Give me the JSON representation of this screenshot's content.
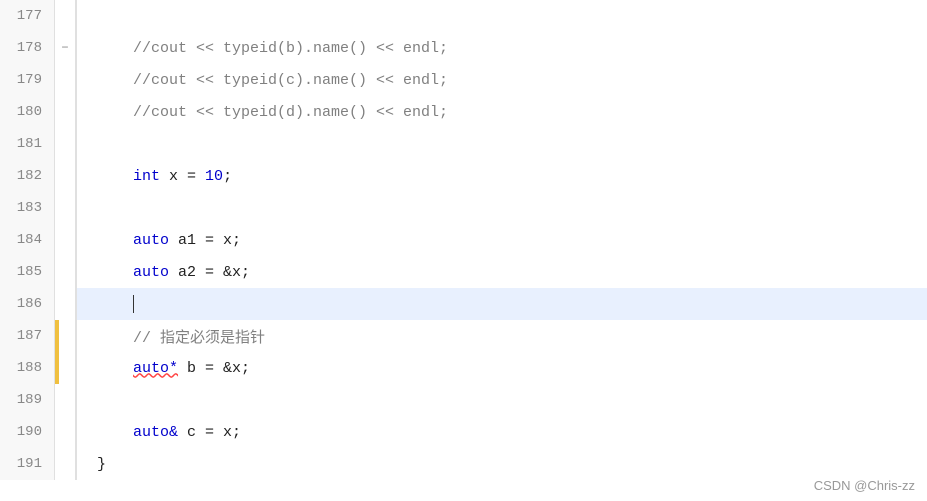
{
  "editor": {
    "lines": [
      {
        "number": "177",
        "gutter": "",
        "gutterStyle": "",
        "content": "",
        "tokens": []
      },
      {
        "number": "178",
        "gutter": "collapse",
        "gutterStyle": "",
        "content": "    //cout << typeid(b).name() << endl;",
        "tokens": [
          {
            "type": "cm",
            "text": "    //cout << typeid(b).name() << endl;"
          }
        ]
      },
      {
        "number": "179",
        "gutter": "",
        "gutterStyle": "",
        "content": "    //cout << typeid(c).name() << endl;",
        "tokens": [
          {
            "type": "cm",
            "text": "    //cout << typeid(c).name() << endl;"
          }
        ]
      },
      {
        "number": "180",
        "gutter": "",
        "gutterStyle": "",
        "content": "    //cout << typeid(d).name() << endl;",
        "tokens": [
          {
            "type": "cm",
            "text": "    //cout << typeid(d).name() << endl;"
          }
        ]
      },
      {
        "number": "181",
        "gutter": "",
        "gutterStyle": "",
        "content": "",
        "tokens": []
      },
      {
        "number": "182",
        "gutter": "",
        "gutterStyle": "",
        "content": "    int x = 10;",
        "tokens": [
          {
            "type": "sp",
            "text": "    "
          },
          {
            "type": "kw",
            "text": "int"
          },
          {
            "type": "id",
            "text": " x = "
          },
          {
            "type": "num",
            "text": "10"
          },
          {
            "type": "id",
            "text": ";"
          }
        ]
      },
      {
        "number": "183",
        "gutter": "",
        "gutterStyle": "",
        "content": "",
        "tokens": []
      },
      {
        "number": "184",
        "gutter": "",
        "gutterStyle": "",
        "content": "    auto a1 = x;",
        "tokens": [
          {
            "type": "sp",
            "text": "    "
          },
          {
            "type": "kw",
            "text": "auto"
          },
          {
            "type": "id",
            "text": " a1 = x;"
          }
        ]
      },
      {
        "number": "185",
        "gutter": "",
        "gutterStyle": "",
        "content": "    auto a2 = &x;",
        "tokens": [
          {
            "type": "sp",
            "text": "    "
          },
          {
            "type": "kw",
            "text": "auto"
          },
          {
            "type": "id",
            "text": " a2 = &x;"
          }
        ]
      },
      {
        "number": "186",
        "gutter": "",
        "gutterStyle": "",
        "content": "cursor",
        "tokens": [
          {
            "type": "cursor",
            "text": ""
          }
        ]
      },
      {
        "number": "187",
        "gutter": "",
        "gutterStyle": "yellow",
        "content": "    // 指定必须是指针",
        "tokens": [
          {
            "type": "cm",
            "text": "    // 指定必须是指针"
          }
        ]
      },
      {
        "number": "188",
        "gutter": "",
        "gutterStyle": "yellow",
        "content": "    auto* b = &x;",
        "tokens": [
          {
            "type": "sp",
            "text": "    "
          },
          {
            "type": "kw-squiggle",
            "text": "auto*"
          },
          {
            "type": "id",
            "text": " b = &x;"
          }
        ]
      },
      {
        "number": "189",
        "gutter": "",
        "gutterStyle": "",
        "content": "",
        "tokens": []
      },
      {
        "number": "190",
        "gutter": "",
        "gutterStyle": "",
        "content": "    auto& c = x;",
        "tokens": [
          {
            "type": "sp",
            "text": "    "
          },
          {
            "type": "kw",
            "text": "auto&"
          },
          {
            "type": "id",
            "text": " c = x;"
          }
        ]
      },
      {
        "number": "191",
        "gutter": "",
        "gutterStyle": "",
        "content": "}",
        "tokens": [
          {
            "type": "id",
            "text": "}"
          }
        ]
      }
    ],
    "watermark": "CSDN @Chris-zz"
  }
}
